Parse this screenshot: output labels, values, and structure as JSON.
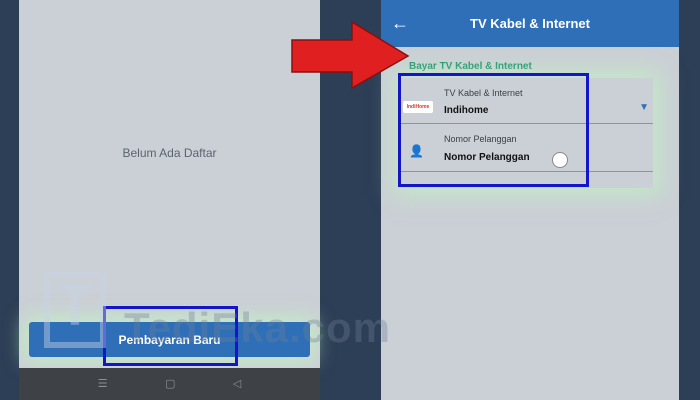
{
  "left_screen": {
    "empty_state_text": "Belum Ada Daftar",
    "pay_button_label": "Pembayaran Baru",
    "nav_icons": [
      "menu-icon",
      "home-square-icon",
      "back-triangle-icon"
    ]
  },
  "right_screen": {
    "header": {
      "title": "TV Kabel & Internet",
      "back_icon": "arrow-left-icon"
    },
    "section_title": "Bayar TV Kabel & Internet",
    "provider_field": {
      "label": "TV Kabel & Internet",
      "value": "Indihome",
      "logo_text": "IndiHome",
      "icon": "chevron-down-icon"
    },
    "customer_field": {
      "label": "Nomor Pelanggan",
      "value": "Nomor Pelanggan",
      "icon": "person-list-icon"
    }
  },
  "watermark": {
    "text": "TediEka.com"
  },
  "colors": {
    "primary": "#2f6fb8",
    "section_title": "#1a8f6b",
    "highlight": "#1414c8",
    "arrow": "#e02020",
    "screen_bg": "#cbcfd6",
    "outer_bg": "#2d3e57"
  }
}
